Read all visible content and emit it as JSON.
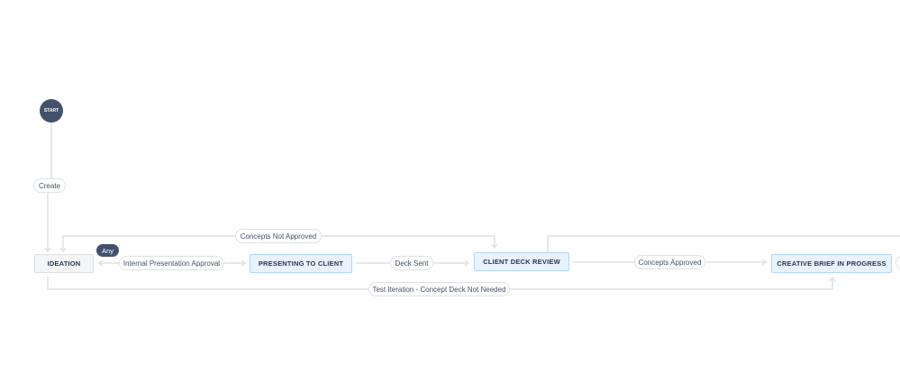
{
  "start": {
    "label": "START"
  },
  "statuses": {
    "ideation": "IDEATION",
    "presenting": "PRESENTING TO CLIENT",
    "client_review": "CLIENT DECK REVIEW",
    "creative_brief": "CREATIVE BRIEF IN PROGRESS"
  },
  "transitions": {
    "create": "Create",
    "concepts_not_approved": "Concepts Not Approved",
    "any": "Any",
    "internal_approval": "Internal Presentation Approval",
    "deck_sent": "Deck Sent",
    "concepts_approved": "Concepts Approved",
    "test_iteration": "Test Iteration - Concept Deck Not Needed"
  },
  "colors": {
    "dark": "#42526e",
    "line": "#dfe1e6",
    "status_blue": "#e9f2ff",
    "status_gray": "#f4f5f7"
  }
}
